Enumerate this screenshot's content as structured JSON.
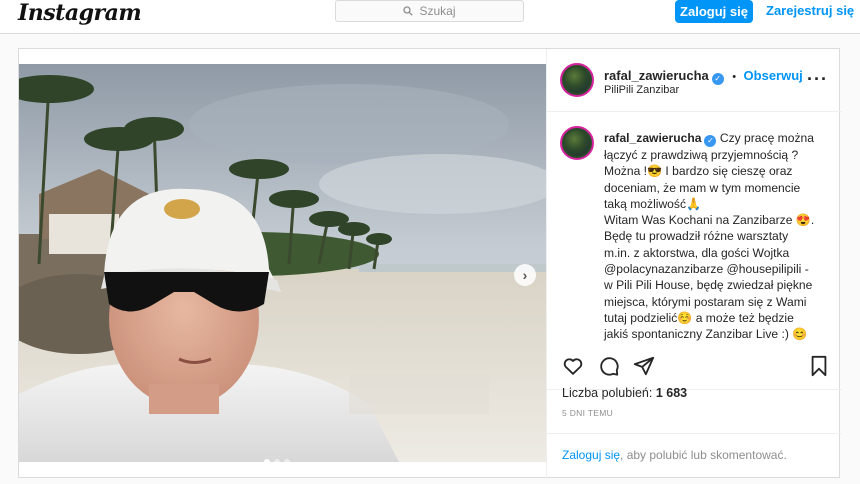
{
  "topbar": {
    "logo": "Instagram",
    "search_placeholder": "Szukaj",
    "login_label": "Zaloguj się",
    "register_label": "Zarejestruj się"
  },
  "post": {
    "username": "rafal_zawierucha",
    "separator": "•",
    "follow_label": "Obserwuj",
    "location": "PiliPili Zanzibar",
    "caption_lines": [
      "Czy pracę można",
      "łączyć z prawdziwą przyjemnością ?",
      "Można !😎 I bardzo się cieszę oraz",
      "doceniam, że mam w tym momencie",
      "taką możliwość🙏",
      "Witam Was Kochani na Zanzibarze 😍.",
      "Będę tu prowadził różne warsztaty",
      "m.in. z aktorstwa, dla gości Wojtka",
      "@polacynazanzibarze @housepilipili -",
      "w Pili Pili House, będę zwiedzał piękne",
      "miejsca, którymi postaram się z Wami",
      "tutaj podzielić☺️ a może też będzie",
      "jakiś spontaniczny Zanzibar Live :) 😊"
    ],
    "likes_label": "Liczba polubień:",
    "likes_count": "1 683",
    "time_ago": "5 DNI TEMU",
    "footer_login": "Zaloguj się",
    "footer_rest": ", aby polubić lub skomentować."
  },
  "colors": {
    "accent": "#0095f6",
    "verified": "#3897f0",
    "border": "#dbdbdb"
  },
  "icons": [
    "search-icon",
    "verified-badge-icon",
    "more-options-icon",
    "heart-icon",
    "comment-icon",
    "share-icon",
    "bookmark-icon",
    "next-arrow-icon"
  ]
}
